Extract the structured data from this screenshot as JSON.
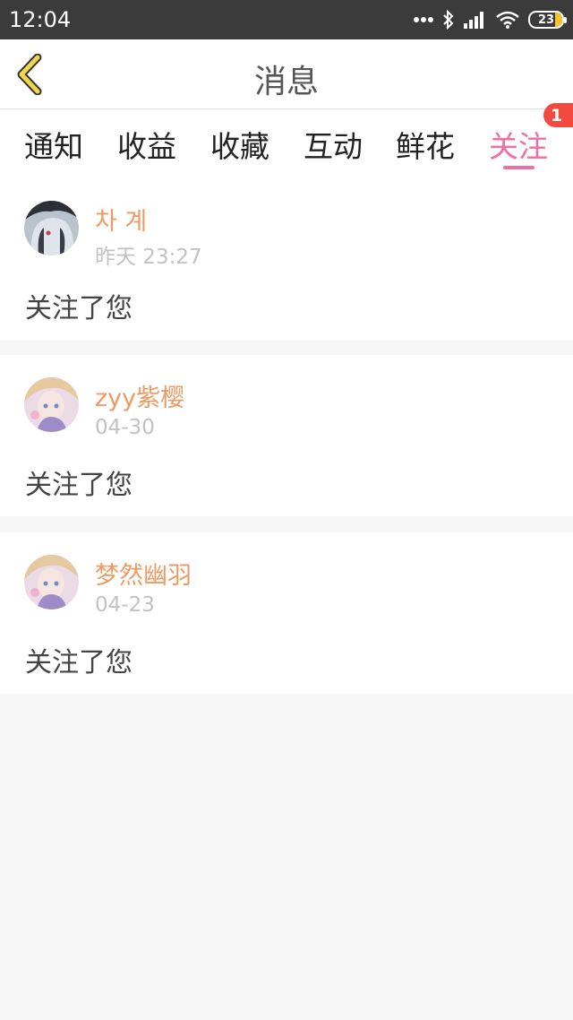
{
  "status_bar": {
    "time": "12:04",
    "battery": "23",
    "icons": [
      "more-dots-icon",
      "bluetooth-icon",
      "signal-icon",
      "wifi-icon",
      "battery-icon"
    ]
  },
  "header": {
    "title": "消息",
    "back_icon": "chevron-left-icon",
    "accent_color": "#f1d54a"
  },
  "tabs": [
    {
      "label": "通知",
      "active": false
    },
    {
      "label": "收益",
      "active": false
    },
    {
      "label": "收藏",
      "active": false
    },
    {
      "label": "互动",
      "active": false
    },
    {
      "label": "鲜花",
      "active": false
    },
    {
      "label": "关注",
      "active": true,
      "badge": "1"
    }
  ],
  "active_tab_color": "#ee6fa3",
  "messages": [
    {
      "username": "차 계",
      "time": "昨天 23:27",
      "text": "关注了您"
    },
    {
      "username": "zyy紫樱",
      "time": "04-30",
      "text": "关注了您"
    },
    {
      "username": "梦然幽羽",
      "time": "04-23",
      "text": "关注了您"
    }
  ],
  "username_color": "#ee9a64"
}
